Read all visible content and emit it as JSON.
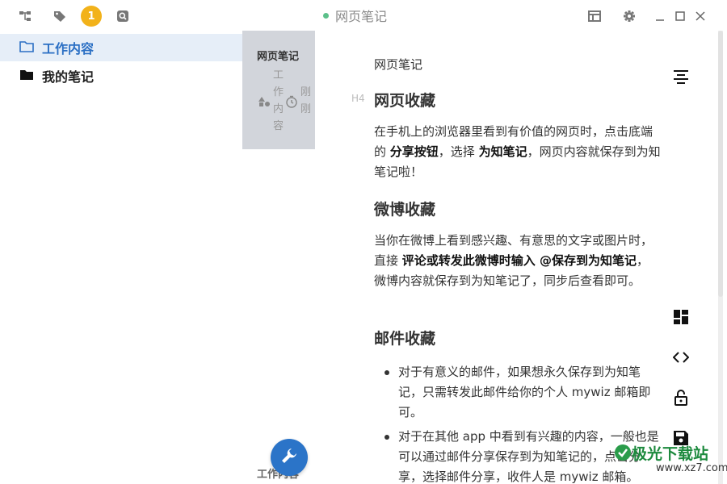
{
  "topbar": {
    "badge_count": "1",
    "window_title": "网页笔记"
  },
  "sidebar": {
    "items": [
      {
        "label": "工作内容",
        "selected": true
      },
      {
        "label": "我的笔记",
        "selected": false
      }
    ]
  },
  "notelist": {
    "note": {
      "title": "网页笔记",
      "category": "工作内容",
      "time": "刚刚"
    },
    "footer_category": "工作内容"
  },
  "editor": {
    "doc_title": "网页笔记",
    "heading_marker": "H4",
    "section1": {
      "heading": "网页收藏",
      "p1_a": "在手机上的浏览器里看到有价值的网页时，点击底端的 ",
      "p1_b": "分享按钮",
      "p1_c": "，选择 ",
      "p1_d": "为知笔记",
      "p1_e": "，网页内容就保存到为知笔记啦！"
    },
    "section2": {
      "heading": "微博收藏",
      "p_a": "当你在微博上看到感兴趣、有意思的文字或图片时，直接 ",
      "p_b": "评论或转发此微博时输入 @保存到为知笔记",
      "p_c": "，微博内容就保存到为知笔记了，同步后查看即可。"
    },
    "section3": {
      "heading": "邮件收藏",
      "bullets": [
        "对于有意义的邮件，如果想永久保存到为知笔记，只需转发此邮件给你的个人 mywiz 邮箱即可。",
        "对于在其他 app 中看到有兴趣的内容，一般也是可以通过邮件分享保存到为知笔记的，点击分享，选择邮件分享，收件人是 mywiz 邮箱。"
      ]
    }
  },
  "watermark": {
    "text": "极光下载站",
    "url": "www.xz7.com"
  },
  "colors": {
    "accent": "#2b74c8",
    "badge": "#f2b21a",
    "selected_bg": "#e6eef8",
    "note_card_bg": "#d2d5db",
    "status_dot": "#5cc08a"
  },
  "icons": [
    "tree-icon",
    "tag-icon",
    "search-icon",
    "layout-icon",
    "gear-icon",
    "minimize-icon",
    "maximize-icon",
    "close-icon",
    "folder-outline-icon",
    "folder-filled-icon",
    "shapes-icon",
    "clock-icon",
    "wrench-icon",
    "align-center-icon",
    "dashboard-icon",
    "code-icon",
    "unlock-icon",
    "save-icon"
  ]
}
